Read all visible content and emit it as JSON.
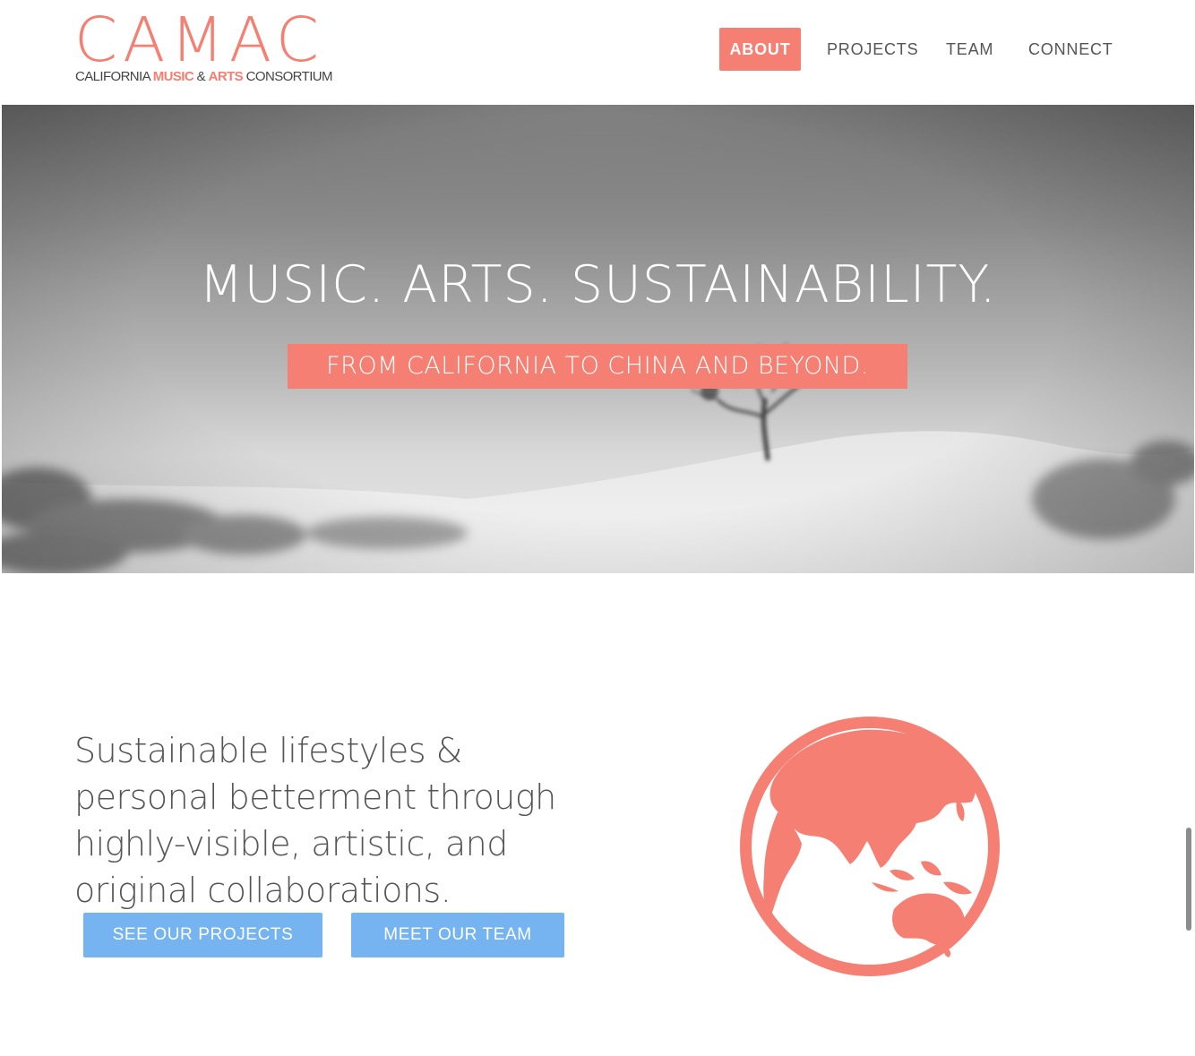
{
  "brand": {
    "logo_text": "CAMAC",
    "sub_1": "CALIFORNIA ",
    "sub_2": "MUSIC",
    "sub_3": " & ",
    "sub_4": "ARTS",
    "sub_5": " CONSORTIUM",
    "accent_color": "#f47f72"
  },
  "nav": {
    "items": [
      {
        "label": "ABOUT",
        "active": true
      },
      {
        "label": "PROJECTS",
        "active": false
      },
      {
        "label": "TEAM",
        "active": false
      },
      {
        "label": "CONNECT",
        "active": false
      }
    ]
  },
  "hero": {
    "title": "MUSIC. ARTS. SUSTAINABILITY.",
    "tagline": "FROM CALIFORNIA TO CHINA AND BEYOND."
  },
  "intro": {
    "mission": "Sustainable lifestyles & personal betterment through highly-visible, artistic, and original collaborations.",
    "buttons": {
      "projects": "SEE OUR PROJECTS",
      "team": "MEET OUR TEAM"
    },
    "button_color": "#75b4f1",
    "globe_icon": "globe-icon"
  }
}
